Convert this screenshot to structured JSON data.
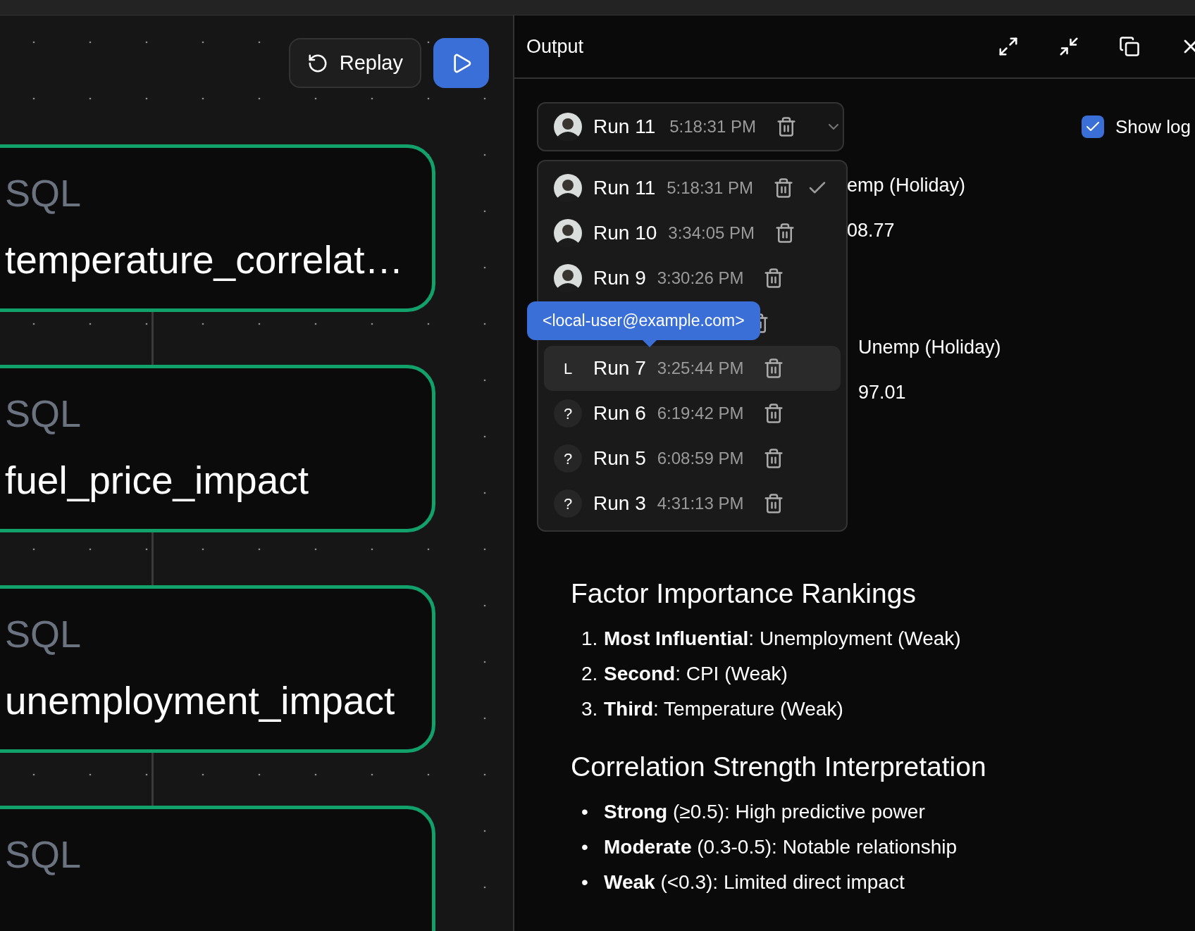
{
  "canvas": {
    "replay_label": "Replay",
    "nodes": [
      {
        "kind_label": "SQL",
        "name": "temperature_correlat…"
      },
      {
        "kind_label": "SQL",
        "name": "fuel_price_impact"
      },
      {
        "kind_label": "SQL",
        "name": "unemployment_impact"
      },
      {
        "kind_label": "SQL"
      }
    ]
  },
  "output": {
    "title": "Output",
    "run_select": {
      "label": "Run 11",
      "time": "5:18:31 PM",
      "avatar": {
        "kind": "photo"
      }
    },
    "show_logs": {
      "label": "Show log",
      "checked": true
    },
    "runs": [
      {
        "kind": "run",
        "avatar": {
          "kind": "photo"
        },
        "label": "Run 11",
        "time": "5:18:31 PM",
        "selected": true,
        "hovered": false
      },
      {
        "kind": "run",
        "avatar": {
          "kind": "photo"
        },
        "label": "Run 10",
        "time": "3:34:05 PM",
        "selected": false,
        "hovered": false
      },
      {
        "kind": "run",
        "avatar": {
          "kind": "photo"
        },
        "label": "Run 9",
        "time": "3:30:26 PM",
        "selected": false,
        "hovered": false
      },
      {
        "kind": "covered"
      },
      {
        "kind": "run",
        "avatar": {
          "kind": "initial",
          "initial": "L"
        },
        "label": "Run 7",
        "time": "3:25:44 PM",
        "selected": false,
        "hovered": true
      },
      {
        "kind": "run",
        "avatar": {
          "kind": "initial",
          "initial": "?"
        },
        "label": "Run 6",
        "time": "6:19:42 PM",
        "selected": false,
        "hovered": false
      },
      {
        "kind": "run",
        "avatar": {
          "kind": "initial",
          "initial": "?"
        },
        "label": "Run 5",
        "time": "6:08:59 PM",
        "selected": false,
        "hovered": false
      },
      {
        "kind": "run",
        "avatar": {
          "kind": "initial",
          "initial": "?"
        },
        "label": "Run 3",
        "time": "4:31:13 PM",
        "selected": false,
        "hovered": false
      }
    ],
    "tooltip": "<local-user@example.com>",
    "partial_groups": [
      [
        "emp (Holiday)",
        "08.77"
      ],
      [
        "Unemp (Holiday)",
        "97.01"
      ]
    ],
    "sections": [
      {
        "title": "Factor Importance Rankings",
        "items": [
          {
            "marker": "1.",
            "text": "**Most Influential**: Unemployment (Weak)"
          },
          {
            "marker": "2.",
            "text": "**Second**: CPI (Weak)"
          },
          {
            "marker": "3.",
            "text": "**Third**: Temperature (Weak)"
          }
        ]
      },
      {
        "title": "Correlation Strength Interpretation",
        "items": [
          {
            "marker": "•",
            "text": "**Strong** (≥0.5): High predictive power"
          },
          {
            "marker": "•",
            "text": "**Moderate** (0.3-0.5): Notable relationship"
          },
          {
            "marker": "•",
            "text": "**Weak** (<0.3): Limited direct impact"
          }
        ]
      }
    ]
  }
}
